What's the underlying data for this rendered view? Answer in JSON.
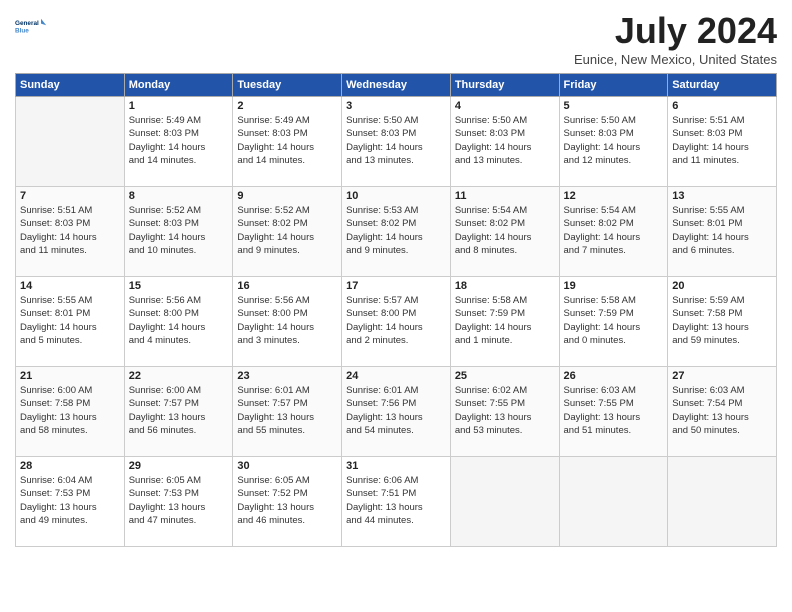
{
  "header": {
    "logo_line1": "General",
    "logo_line2": "Blue",
    "month_title": "July 2024",
    "location": "Eunice, New Mexico, United States"
  },
  "weekdays": [
    "Sunday",
    "Monday",
    "Tuesday",
    "Wednesday",
    "Thursday",
    "Friday",
    "Saturday"
  ],
  "weeks": [
    [
      {
        "day": "",
        "text": ""
      },
      {
        "day": "1",
        "text": "Sunrise: 5:49 AM\nSunset: 8:03 PM\nDaylight: 14 hours\nand 14 minutes."
      },
      {
        "day": "2",
        "text": "Sunrise: 5:49 AM\nSunset: 8:03 PM\nDaylight: 14 hours\nand 14 minutes."
      },
      {
        "day": "3",
        "text": "Sunrise: 5:50 AM\nSunset: 8:03 PM\nDaylight: 14 hours\nand 13 minutes."
      },
      {
        "day": "4",
        "text": "Sunrise: 5:50 AM\nSunset: 8:03 PM\nDaylight: 14 hours\nand 13 minutes."
      },
      {
        "day": "5",
        "text": "Sunrise: 5:50 AM\nSunset: 8:03 PM\nDaylight: 14 hours\nand 12 minutes."
      },
      {
        "day": "6",
        "text": "Sunrise: 5:51 AM\nSunset: 8:03 PM\nDaylight: 14 hours\nand 11 minutes."
      }
    ],
    [
      {
        "day": "7",
        "text": "Sunrise: 5:51 AM\nSunset: 8:03 PM\nDaylight: 14 hours\nand 11 minutes."
      },
      {
        "day": "8",
        "text": "Sunrise: 5:52 AM\nSunset: 8:03 PM\nDaylight: 14 hours\nand 10 minutes."
      },
      {
        "day": "9",
        "text": "Sunrise: 5:52 AM\nSunset: 8:02 PM\nDaylight: 14 hours\nand 9 minutes."
      },
      {
        "day": "10",
        "text": "Sunrise: 5:53 AM\nSunset: 8:02 PM\nDaylight: 14 hours\nand 9 minutes."
      },
      {
        "day": "11",
        "text": "Sunrise: 5:54 AM\nSunset: 8:02 PM\nDaylight: 14 hours\nand 8 minutes."
      },
      {
        "day": "12",
        "text": "Sunrise: 5:54 AM\nSunset: 8:02 PM\nDaylight: 14 hours\nand 7 minutes."
      },
      {
        "day": "13",
        "text": "Sunrise: 5:55 AM\nSunset: 8:01 PM\nDaylight: 14 hours\nand 6 minutes."
      }
    ],
    [
      {
        "day": "14",
        "text": "Sunrise: 5:55 AM\nSunset: 8:01 PM\nDaylight: 14 hours\nand 5 minutes."
      },
      {
        "day": "15",
        "text": "Sunrise: 5:56 AM\nSunset: 8:00 PM\nDaylight: 14 hours\nand 4 minutes."
      },
      {
        "day": "16",
        "text": "Sunrise: 5:56 AM\nSunset: 8:00 PM\nDaylight: 14 hours\nand 3 minutes."
      },
      {
        "day": "17",
        "text": "Sunrise: 5:57 AM\nSunset: 8:00 PM\nDaylight: 14 hours\nand 2 minutes."
      },
      {
        "day": "18",
        "text": "Sunrise: 5:58 AM\nSunset: 7:59 PM\nDaylight: 14 hours\nand 1 minute."
      },
      {
        "day": "19",
        "text": "Sunrise: 5:58 AM\nSunset: 7:59 PM\nDaylight: 14 hours\nand 0 minutes."
      },
      {
        "day": "20",
        "text": "Sunrise: 5:59 AM\nSunset: 7:58 PM\nDaylight: 13 hours\nand 59 minutes."
      }
    ],
    [
      {
        "day": "21",
        "text": "Sunrise: 6:00 AM\nSunset: 7:58 PM\nDaylight: 13 hours\nand 58 minutes."
      },
      {
        "day": "22",
        "text": "Sunrise: 6:00 AM\nSunset: 7:57 PM\nDaylight: 13 hours\nand 56 minutes."
      },
      {
        "day": "23",
        "text": "Sunrise: 6:01 AM\nSunset: 7:57 PM\nDaylight: 13 hours\nand 55 minutes."
      },
      {
        "day": "24",
        "text": "Sunrise: 6:01 AM\nSunset: 7:56 PM\nDaylight: 13 hours\nand 54 minutes."
      },
      {
        "day": "25",
        "text": "Sunrise: 6:02 AM\nSunset: 7:55 PM\nDaylight: 13 hours\nand 53 minutes."
      },
      {
        "day": "26",
        "text": "Sunrise: 6:03 AM\nSunset: 7:55 PM\nDaylight: 13 hours\nand 51 minutes."
      },
      {
        "day": "27",
        "text": "Sunrise: 6:03 AM\nSunset: 7:54 PM\nDaylight: 13 hours\nand 50 minutes."
      }
    ],
    [
      {
        "day": "28",
        "text": "Sunrise: 6:04 AM\nSunset: 7:53 PM\nDaylight: 13 hours\nand 49 minutes."
      },
      {
        "day": "29",
        "text": "Sunrise: 6:05 AM\nSunset: 7:53 PM\nDaylight: 13 hours\nand 47 minutes."
      },
      {
        "day": "30",
        "text": "Sunrise: 6:05 AM\nSunset: 7:52 PM\nDaylight: 13 hours\nand 46 minutes."
      },
      {
        "day": "31",
        "text": "Sunrise: 6:06 AM\nSunset: 7:51 PM\nDaylight: 13 hours\nand 44 minutes."
      },
      {
        "day": "",
        "text": ""
      },
      {
        "day": "",
        "text": ""
      },
      {
        "day": "",
        "text": ""
      }
    ]
  ]
}
